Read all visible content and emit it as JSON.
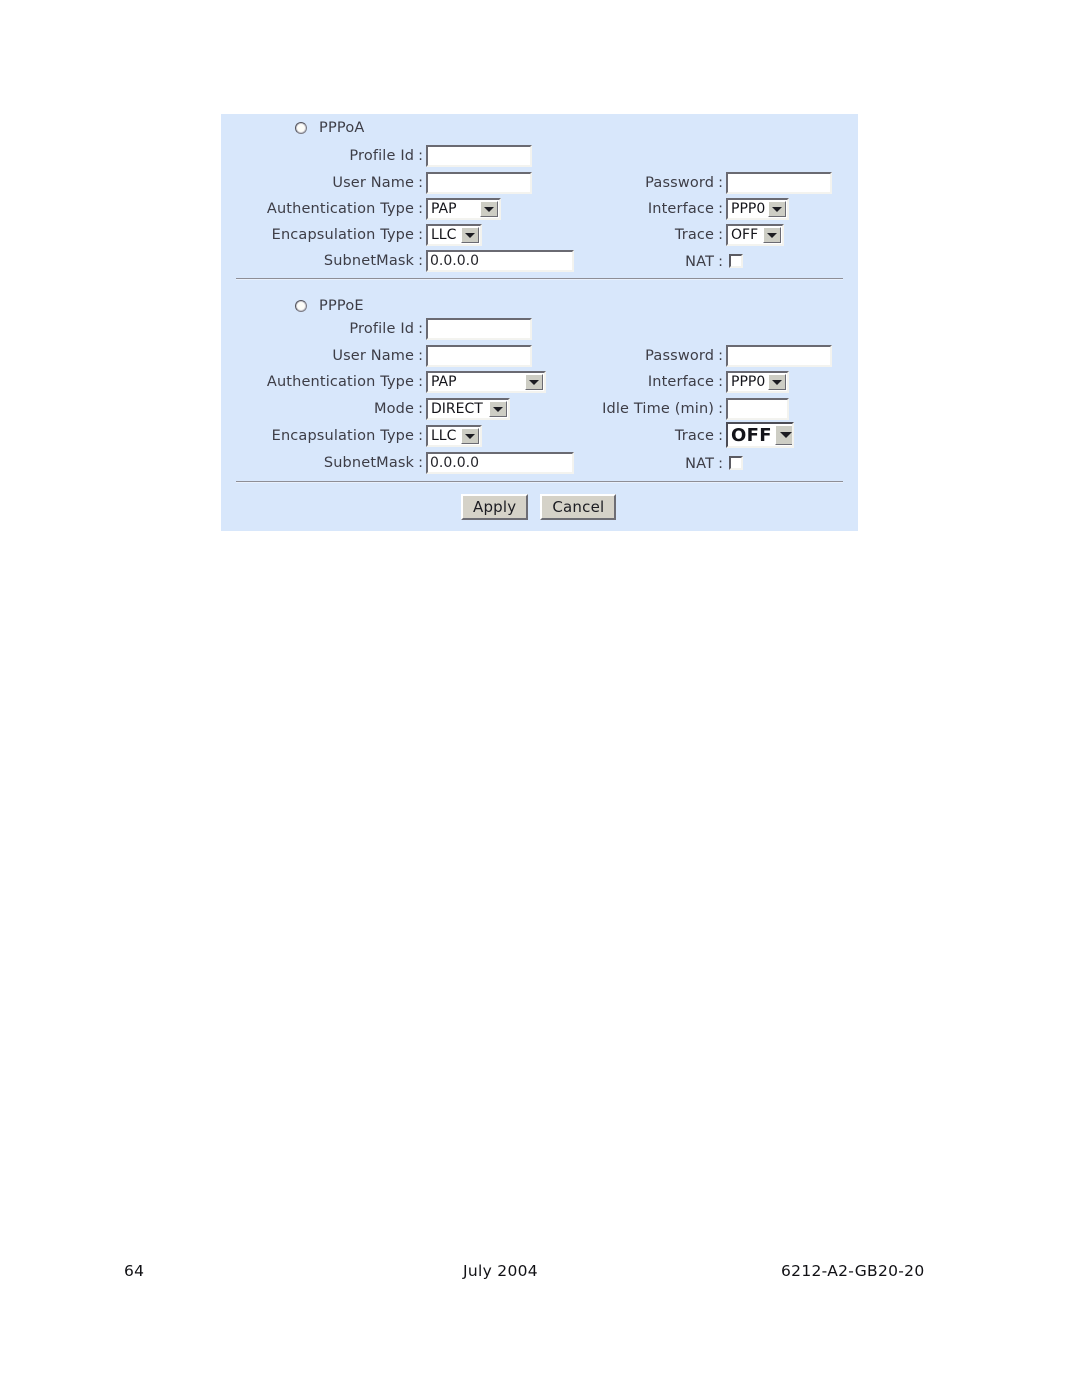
{
  "page": {
    "background": "#ffffff",
    "panel_background": "#d8e7fb"
  },
  "form": {
    "sections": [
      {
        "id": "pppoa",
        "radio_label": "PPPoA",
        "radio_checked": false,
        "left_fields": [
          {
            "label": "Profile Id",
            "colon": ":",
            "type": "text",
            "value": "",
            "placeholder": ""
          },
          {
            "label": "User Name",
            "colon": ":",
            "type": "text",
            "value": "",
            "placeholder": ""
          },
          {
            "label": "Authentication Type",
            "colon": ":",
            "type": "select",
            "value": "PAP"
          },
          {
            "label": "Encapsulation Type",
            "colon": ":",
            "type": "select",
            "value": "LLC"
          },
          {
            "label": "SubnetMask",
            "colon": ":",
            "type": "text",
            "value": "0.0.0.0",
            "placeholder": ""
          }
        ],
        "right_fields": [
          {
            "label": "Password",
            "colon": ":",
            "type": "text",
            "value": "",
            "placeholder": ""
          },
          {
            "label": "Interface",
            "colon": ":",
            "type": "select",
            "value": "PPP0"
          },
          {
            "label": "Trace",
            "colon": ":",
            "type": "select",
            "value": "OFF"
          },
          {
            "label": "NAT",
            "colon": ":",
            "type": "checkbox",
            "checked": false
          }
        ]
      },
      {
        "id": "pppoe",
        "radio_label": "PPPoE",
        "radio_checked": false,
        "left_fields": [
          {
            "label": "Profile Id",
            "colon": ":",
            "type": "text",
            "value": "",
            "placeholder": ""
          },
          {
            "label": "User Name",
            "colon": ":",
            "type": "text",
            "value": "",
            "placeholder": ""
          },
          {
            "label": "Authentication Type",
            "colon": ":",
            "type": "select",
            "value": "PAP"
          },
          {
            "label": "Mode",
            "colon": ":",
            "type": "select",
            "value": "DIRECT"
          },
          {
            "label": "Encapsulation Type",
            "colon": ":",
            "type": "select",
            "value": "LLC"
          },
          {
            "label": "SubnetMask",
            "colon": ":",
            "type": "text",
            "value": "0.0.0.0",
            "placeholder": ""
          }
        ],
        "right_fields": [
          {
            "label": "Password",
            "colon": ":",
            "type": "text",
            "value": "",
            "placeholder": ""
          },
          {
            "label": "Interface",
            "colon": ":",
            "type": "select",
            "value": "PPP0"
          },
          {
            "label": "Idle Time (min)",
            "colon": ":",
            "type": "text",
            "value": "",
            "placeholder": ""
          },
          {
            "label": "Trace",
            "colon": ":",
            "type": "select",
            "value": "OFF"
          },
          {
            "label": "NAT",
            "colon": ":",
            "type": "checkbox",
            "checked": false
          }
        ]
      }
    ],
    "buttons": {
      "apply": "Apply",
      "cancel": "Cancel"
    }
  },
  "footer": {
    "page_number": "64",
    "date": "July 2004",
    "document_number": "6212-A2-GB20-20"
  }
}
